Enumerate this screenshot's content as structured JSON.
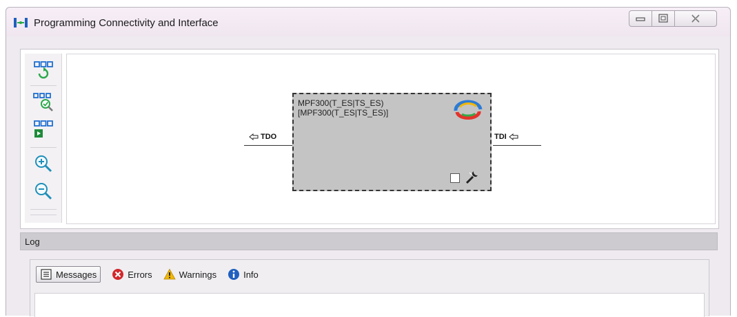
{
  "window": {
    "title": "Programming Connectivity and Interface"
  },
  "toolbar": {
    "icons": [
      "refresh-chain-icon",
      "scan-chain-icon",
      "run-chain-icon",
      "zoom-in-icon",
      "zoom-out-icon"
    ]
  },
  "diagram": {
    "device_name": "MPF300(T_ES|TS_ES)",
    "device_subtitle": "[MPF300(T_ES|TS_ES)]",
    "port_left": "TDO",
    "port_right": "TDI"
  },
  "log": {
    "header": "Log",
    "tabs": [
      {
        "label": "Messages",
        "icon": "messages-icon"
      },
      {
        "label": "Errors",
        "icon": "error-icon"
      },
      {
        "label": "Warnings",
        "icon": "warning-icon"
      },
      {
        "label": "Info",
        "icon": "info-icon"
      }
    ]
  },
  "colors": {
    "device_fill": "#c4c4c4",
    "error_red": "#d2272b",
    "warning_yellow": "#f2b705",
    "info_blue": "#1f5fbf",
    "toolbar_blue": "#1e6fd0",
    "toolbar_green": "#2aa84a"
  }
}
